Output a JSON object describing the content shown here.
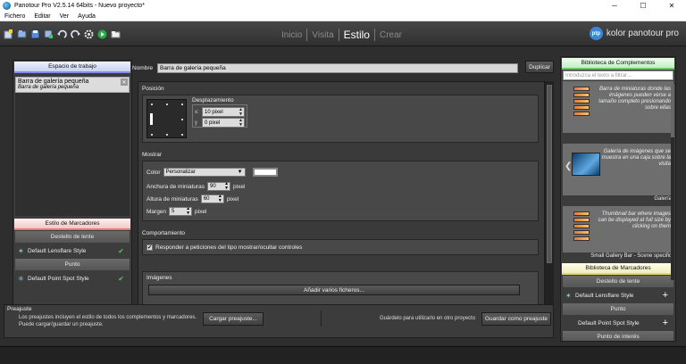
{
  "window": {
    "title": "Panotour Pro V2.5.14 64bits - Nuevo proyecto*",
    "minimize": "─",
    "maximize": "☐",
    "close": "✕"
  },
  "menu": [
    "Fichero",
    "Editar",
    "Ver",
    "Ayuda"
  ],
  "toolbar_icons": [
    "new-project-icon",
    "open-project-icon",
    "save-project-icon",
    "save-as-icon",
    "undo-icon",
    "redo-icon",
    "settings-icon",
    "build-play-icon",
    "folder-icon"
  ],
  "tabs": [
    {
      "label": "Inicio",
      "active": false
    },
    {
      "label": "Visita",
      "active": false
    },
    {
      "label": "Estilo",
      "active": true
    },
    {
      "label": "Crear",
      "active": false
    }
  ],
  "brand": {
    "logo": "ptp",
    "name": "kolor panotour pro"
  },
  "workspace": {
    "header": "Espacio de trabajo",
    "item_title": "Barra de galería pequeña",
    "item_subtitle": "Barra de galería pequeña",
    "remove": "✕"
  },
  "markers_style": {
    "header": "Estilo de Marcadores",
    "lens_section": "Destello de lente",
    "lens_item": "Default Lensflare Style",
    "point_section": "Punto",
    "point_item": "Default Point Spot Style"
  },
  "editor": {
    "name_label": "Nombre",
    "name_value": "Barra de galería pequeña",
    "duplicate": "Duplicar",
    "position": {
      "title": "Posición",
      "offset_title": "Desplazamiento",
      "x_label": "x:",
      "x_value": "10 pixel",
      "y_label": "y",
      "y_value": "0 pixel"
    },
    "show": {
      "title": "Mostrar",
      "color_label": "Color",
      "color_value": "Personalizar",
      "thumb_width_label": "Anchura de miniaturas",
      "thumb_width_value": "90",
      "thumb_height_label": "Altura de miniaturas",
      "thumb_height_value": "60",
      "margin_label": "Margen",
      "margin_value": "5",
      "unit": "pixel",
      "swatch": "#ffffff"
    },
    "behavior": {
      "title": "Comportamiento",
      "checkbox_label": "Responder a peticiones del tipo mostrar/ocultar controles",
      "checked": true
    },
    "images": {
      "title": "Imágenes",
      "add_button": "Añadir varios ficheros..."
    }
  },
  "presets": {
    "title": "Preajuste",
    "desc_line1": "Los preajustes incluyen el estilo de todos los complementos y marcadores.",
    "desc_line2": "Puede cargar/guardar un preajuste.",
    "load": "Cargar preajuste...",
    "save_desc": "Guárdelo para utilizarlo en otro proyecto",
    "save": "Guardar como preajuste"
  },
  "plugins_library": {
    "header": "Biblioteca de Complementos",
    "search_placeholder": "Introduzca el texto a filtrar...",
    "cards": [
      {
        "desc": "Barra de miniaturas donde las imágenes pueden verse a tamaño completo presionando sobre ellas",
        "label": ""
      },
      {
        "desc": "Galería de imágenes que se muestra en una caja sobre la visita",
        "label": "Galería"
      },
      {
        "desc": "Thumbnail bar where images can be displayed at full size by clicking on them",
        "label": "Small Gallery Bar - Scene specific"
      }
    ]
  },
  "markers_library": {
    "header": "Biblioteca de Marcadores",
    "lens_section": "Destello de lente",
    "lens_item": "Default Lensflare Style",
    "point_section": "Punto",
    "point_item": "Default Point Spot Style",
    "poi_section": "Punto de interés",
    "add": "+"
  },
  "colors": {
    "background": "#2e2e2e",
    "panel": "#3c3c3c",
    "accent_blue": "#7a8fe6",
    "accent_red": "#e07a7a",
    "accent_green": "#6acb6a",
    "accent_yellow": "#e3d66a",
    "check": "#5ec25e"
  }
}
